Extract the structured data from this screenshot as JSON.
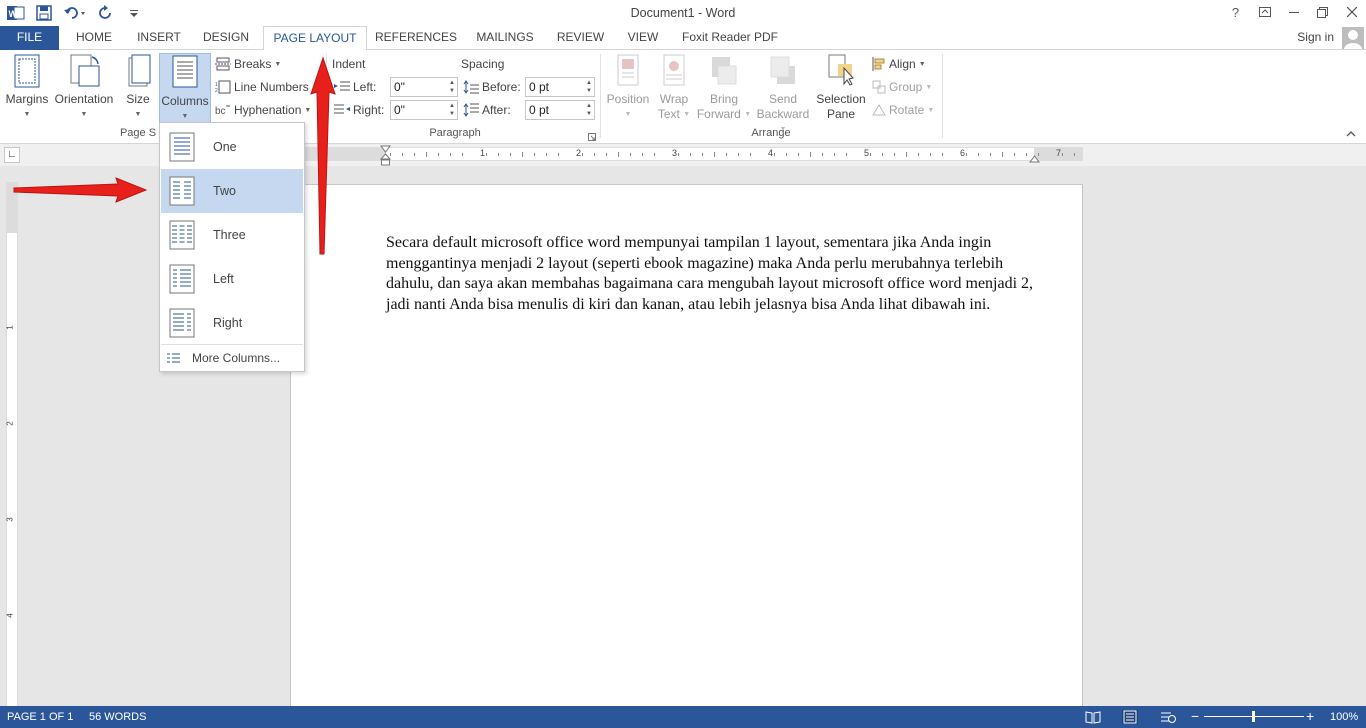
{
  "title_bar": {
    "document_title": "Document1 - Word",
    "controls": [
      "?",
      "restore-ribbon",
      "minimize",
      "maximize",
      "close"
    ]
  },
  "tabs": [
    {
      "label": "FILE"
    },
    {
      "label": "HOME"
    },
    {
      "label": "INSERT"
    },
    {
      "label": "DESIGN"
    },
    {
      "label": "PAGE LAYOUT"
    },
    {
      "label": "REFERENCES"
    },
    {
      "label": "MAILINGS"
    },
    {
      "label": "REVIEW"
    },
    {
      "label": "VIEW"
    },
    {
      "label": "Foxit Reader PDF"
    }
  ],
  "active_tab": "PAGE LAYOUT",
  "sign_in": "Sign in",
  "ribbon": {
    "page_setup": {
      "margins": "Margins",
      "orientation": "Orientation",
      "size": "Size",
      "columns": "Columns",
      "breaks": "Breaks",
      "line_numbers": "Line Numbers",
      "hyphenation": "Hyphenation",
      "group_label": "Page S"
    },
    "paragraph": {
      "indent_header": "Indent",
      "spacing_header": "Spacing",
      "left_label": "Left:",
      "right_label": "Right:",
      "before_label": "Before:",
      "after_label": "After:",
      "left_value": "0\"",
      "right_value": "0\"",
      "before_value": "0 pt",
      "after_value": "0 pt",
      "group_label": "Paragraph"
    },
    "arrange": {
      "position": "Position",
      "wrap_text_1": "Wrap",
      "wrap_text_2": "Text",
      "bring_forward_1": "Bring",
      "bring_forward_2": "Forward",
      "send_backward_1": "Send",
      "send_backward_2": "Backward",
      "selection_pane_1": "Selection",
      "selection_pane_2": "Pane",
      "align": "Align",
      "group": "Group",
      "rotate": "Rotate",
      "group_label": "Arrange"
    }
  },
  "columns_menu": {
    "items": [
      {
        "label": "One"
      },
      {
        "label": "Two"
      },
      {
        "label": "Three"
      },
      {
        "label": "Left"
      },
      {
        "label": "Right"
      }
    ],
    "highlighted": "Two",
    "more": "More Columns..."
  },
  "ruler": {
    "horizontal_numbers": [
      "1",
      "2",
      "3",
      "4",
      "5",
      "6",
      "7"
    ],
    "vertical_numbers": [
      "1",
      "2",
      "3",
      "4"
    ]
  },
  "document": {
    "body_text": "Secara default microsoft office word mempunyai tampilan 1 layout, sementara jika Anda ingin menggantinya menjadi 2 layout (seperti ebook magazine) maka Anda perlu merubahnya terlebih dahulu, dan saya akan membahas bagaimana cara mengubah layout microsoft office word menjadi 2, jadi nanti Anda bisa menulis di kiri dan kanan, atau lebih jelasnya bisa Anda lihat dibawah ini."
  },
  "status_bar": {
    "page": "PAGE 1 OF 1",
    "words": "56 WORDS",
    "zoom": "100%",
    "zoom_minus": "−",
    "zoom_plus": "+",
    "zoom_level_fraction": 0.5
  },
  "colors": {
    "brand": "#2b579a",
    "highlight": "#c5d8f0",
    "arrow": "#e8201c"
  }
}
